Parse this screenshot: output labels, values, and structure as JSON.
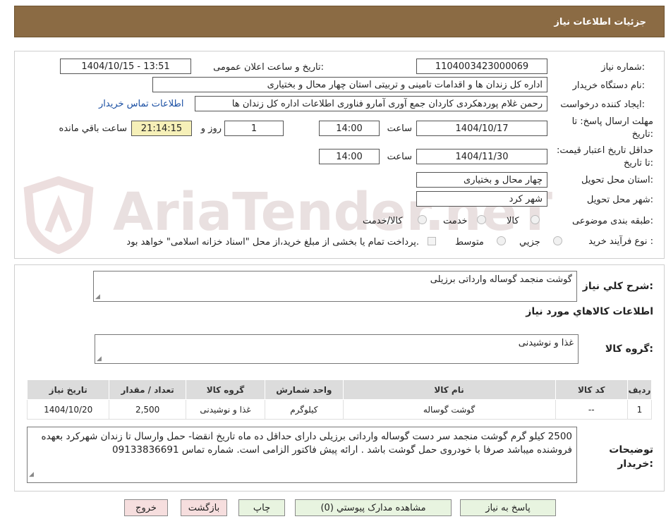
{
  "header": {
    "title": "جزئیات اطلاعات نیاز"
  },
  "watermark": {
    "text": "AriaTender.neT"
  },
  "fields": {
    "need_number": {
      "label": "شماره نیاز:",
      "value": "1104003423000069"
    },
    "announce_datetime": {
      "label": "تاریخ و ساعت اعلان عمومی:",
      "value": "1404/10/15 - 13:51"
    },
    "buyer_org": {
      "label": "نام دستگاه خریدار:",
      "value": "اداره کل زندان ها و اقدامات تامینی و تربیتی استان چهار محال و بختیاری"
    },
    "requester": {
      "label": "ایجاد کننده درخواست:",
      "value": "رحمن غلام پوردهکردی کاردان جمع آوری آمارو فناوری اطلاعات اداره کل زندان ها",
      "contact_link": "اطلاعات تماس خریدار"
    },
    "reply_deadline": {
      "label": "مهلت ارسال پاسخ: تا تاریخ:",
      "date": "1404/10/17",
      "time_label": "ساعت",
      "time": "14:00",
      "days": "1",
      "days_label": "روز و",
      "remaining": "21:14:15",
      "remaining_label": "ساعت باقي مانده"
    },
    "price_validity": {
      "label": "حداقل تاریخ اعتبار قیمت: تا تاریخ:",
      "date": "1404/11/30",
      "time_label": "ساعت",
      "time": "14:00"
    },
    "delivery_province": {
      "label": "استان محل تحویل:",
      "value": "چهار محال و بختیاری"
    },
    "delivery_city": {
      "label": "شهر محل تحویل:",
      "value": "شهر کرد"
    },
    "category": {
      "label": "طبقه بندی موضوعی:",
      "options": [
        "کالا",
        "خدمت",
        "کالا/خدمت"
      ]
    },
    "process_type": {
      "label": "نوع فرآیند خرید :",
      "options": [
        "جزیي",
        "متوسط"
      ],
      "payment_note": "پرداخت تمام یا بخشی از مبلغ خرید،از محل \"اسناد خزانه اسلامی\" خواهد بود."
    }
  },
  "summary": {
    "label": "شرح کلي نیاز:",
    "value": "گوشت منجمد  گوساله وارداتی برزیلی"
  },
  "goods_info": {
    "title": "اطلاعات کالاهاي مورد نیاز"
  },
  "goods_group": {
    "label": "گروه کالا:",
    "value": "غذا و نوشیدنی"
  },
  "table": {
    "headers": [
      "ردیف",
      "کد کالا",
      "نام کالا",
      "واحد شمارش",
      "گروه کالا",
      "تعداد / مقدار",
      "تاریخ نیاز"
    ],
    "rows": [
      [
        "1",
        "--",
        "گوشت گوساله",
        "کیلوگرم",
        "غذا و نوشیدنی",
        "2,500",
        "1404/10/20"
      ]
    ]
  },
  "buyer_notes": {
    "label": "توضیحات خریدار:",
    "value": "2500 کیلو گرم گوشت منجمد سر دست گوساله  وارداتی برزیلی دارای حداقل ده ماه تاریخ انقضا- حمل وارسال تا زندان شهرکرد بعهده فروشنده میباشد صرفا با خودروی حمل گوشت باشد . ارائه پیش فاکتور الزامی است. شماره تماس 09133836691"
  },
  "buttons": {
    "reply": "پاسخ به نیاز",
    "attachments": "مشاهده مدارک پیوستي (0)",
    "print": "چاپ",
    "back": "بازگشت",
    "exit": "خروج"
  }
}
